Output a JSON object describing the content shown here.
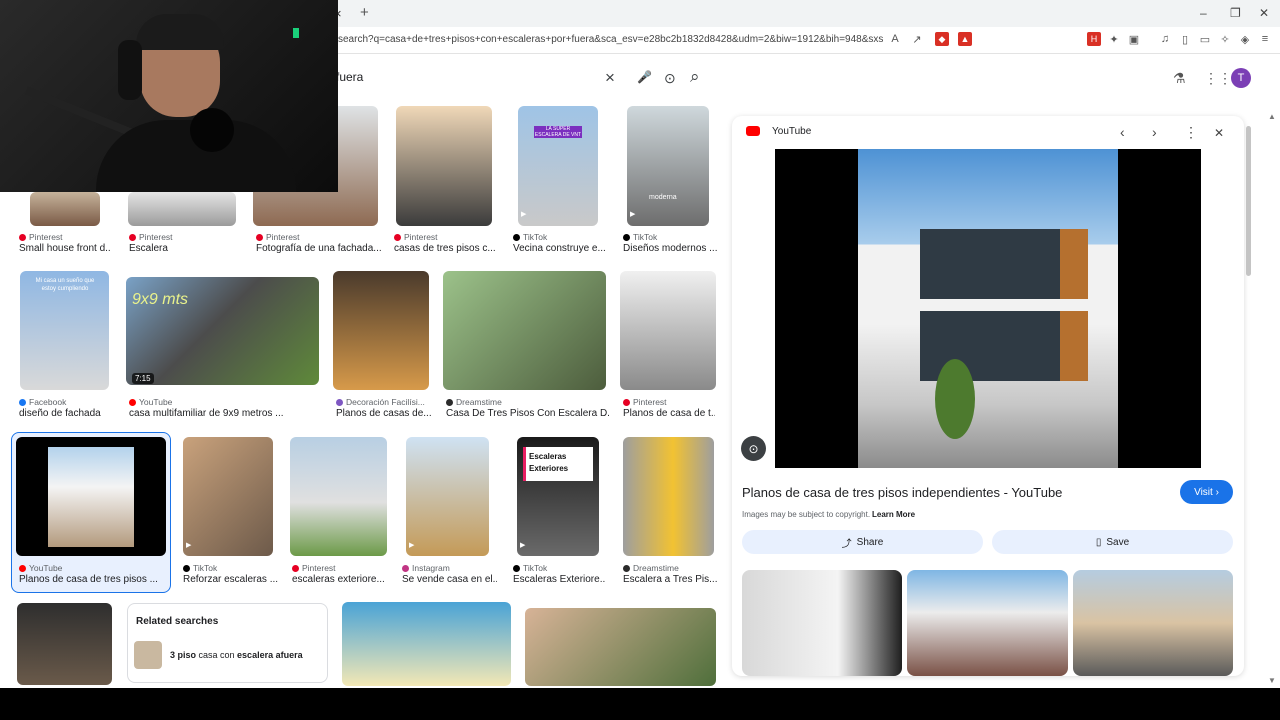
{
  "browser": {
    "tab_close": "×",
    "tab_new": "+",
    "url": "search?q=casa+de+tres+pisos+con+escaleras+por+fuera&sca_esv=e28bc2b1832d8428&udm=2&biw=1912&bih=948&sxsrf=AE...",
    "minimize": "–",
    "restore": "❐",
    "close": "✕"
  },
  "search": {
    "query": "fuera",
    "clear_icon": "×",
    "mic_icon": "🎤",
    "lens_icon": "⊙",
    "search_icon": "⌕",
    "avatar_letter": "T"
  },
  "results": [
    {
      "source": "Pinterest",
      "caption": "Small house front d...",
      "color": "#e60023"
    },
    {
      "source": "Pinterest",
      "caption": "Escalera",
      "color": "#e60023"
    },
    {
      "source": "Pinterest",
      "caption": "Fotografía de una fachada...",
      "color": "#e60023"
    },
    {
      "source": "Pinterest",
      "caption": "casas de tres pisos c...",
      "color": "#e60023"
    },
    {
      "source": "TikTok",
      "caption": "Vecina construye e...",
      "color": "#000000"
    },
    {
      "source": "TikTok",
      "caption": "Diseños modernos ...",
      "color": "#000000"
    },
    {
      "source": "Facebook",
      "caption": "diseño de fachada",
      "color": "#1877f2"
    },
    {
      "source": "YouTube",
      "caption": "casa multifamiliar de 9x9 metros ...",
      "color": "#ff0000"
    },
    {
      "source": "Decoración Facilísi...",
      "caption": "Planos de casas de...",
      "color": "#7e57c2"
    },
    {
      "source": "Dreamstime",
      "caption": "Casa De Tres Pisos Con Escalera D...",
      "color": "#2b2b2b"
    },
    {
      "source": "Pinterest",
      "caption": "Planos de casa de t...",
      "color": "#e60023"
    },
    {
      "source": "YouTube",
      "caption": "Planos de casa de tres pisos ...",
      "color": "#ff0000"
    },
    {
      "source": "TikTok",
      "caption": "Reforzar escaleras ...",
      "color": "#000000"
    },
    {
      "source": "Pinterest",
      "caption": "escaleras exteriore...",
      "color": "#e60023"
    },
    {
      "source": "Instagram",
      "caption": "Se vende casa en el...",
      "color": "#c13584"
    },
    {
      "source": "TikTok",
      "caption": "Escaleras Exteriore...",
      "color": "#000000"
    },
    {
      "source": "Dreamstime",
      "caption": "Escalera a Tres Pis...",
      "color": "#2b2b2b"
    }
  ],
  "overlays": {
    "thumb_text_1": "Mi casa un sueño que estoy cumpliendo",
    "thumb_text_2": "9x9 mts",
    "duration": "7:15",
    "escalera_text": "LA SUPER ESCALERA DE VNT",
    "escaleras_label": "Escaleras Exteriores",
    "modern_label": "moderna"
  },
  "related": {
    "title": "Related searches",
    "item_bold1": "3 piso",
    "item_mid": " casa con ",
    "item_bold2": "escalera afuera"
  },
  "panel": {
    "source": "YouTube",
    "title": "Planos de casa de tres pisos independientes - YouTube",
    "visit": "Visit",
    "copyright": "Images may be subject to copyright.",
    "learn_more": "Learn More",
    "share": "Share",
    "save": "Save",
    "prev": "‹",
    "next": "›",
    "more": "⋮",
    "close": "✕"
  }
}
